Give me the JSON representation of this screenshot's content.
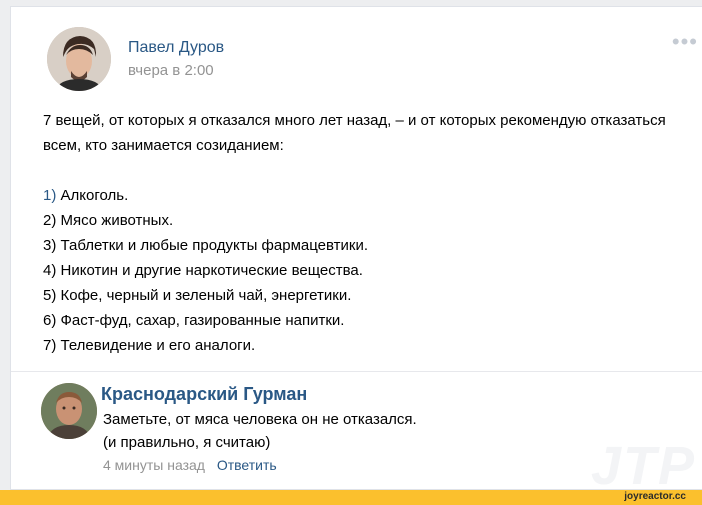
{
  "post": {
    "author": "Павел Дуров",
    "time": "вчера в 2:00",
    "intro": "7 вещей, от которых я отказался много лет назад, – и от которых рекомендую отказаться всем, кто занимается созиданием:",
    "items": [
      {
        "num": "1)",
        "text": " Алкоголь."
      },
      {
        "num": "2)",
        "text": " Мясо животных."
      },
      {
        "num": "3)",
        "text": " Таблетки и любые продукты фармацевтики."
      },
      {
        "num": "4)",
        "text": " Никотин и другие наркотические вещества."
      },
      {
        "num": "5)",
        "text": " Кофе, черный и зеленый чай, энергетики."
      },
      {
        "num": "6)",
        "text": " Фаст-фуд, сахар, газированные напитки."
      },
      {
        "num": "7)",
        "text": " Телевидение и его аналоги."
      }
    ],
    "more_icon": "more-horizontal-icon"
  },
  "comment": {
    "author": "Краснодарский Гурман",
    "line1": "Заметьте, от мяса человека он не отказался.",
    "line2": "(и правильно, я считаю)",
    "time": "4 минуты назад",
    "reply_label": "Ответить"
  },
  "watermark": "JTP",
  "footer": {
    "site": "joyreactor.cc"
  },
  "colors": {
    "link": "#2a5885",
    "meta": "#939393",
    "bar": "#fbc02d"
  }
}
